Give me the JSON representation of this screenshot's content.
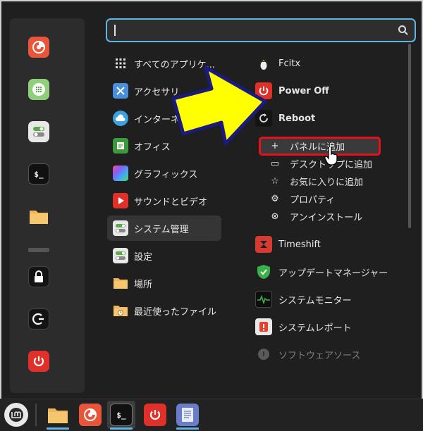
{
  "search": {
    "value": "",
    "placeholder": ""
  },
  "categories": [
    {
      "label": "すべてのアプリケ...",
      "icon": "grid-icon"
    },
    {
      "label": "アクセサリ",
      "icon": "accessories-icon"
    },
    {
      "label": "インターネ",
      "icon": "internet-icon"
    },
    {
      "label": "オフィス",
      "icon": "office-icon"
    },
    {
      "label": "グラフィックス",
      "icon": "graphics-icon"
    },
    {
      "label": "サウンドとビデオ",
      "icon": "multimedia-icon"
    },
    {
      "label": "システム管理",
      "icon": "system-admin-icon"
    },
    {
      "label": "設定",
      "icon": "settings-icon"
    },
    {
      "label": "場所",
      "icon": "folder-icon"
    },
    {
      "label": "最近使ったファイル",
      "icon": "recent-files-icon"
    }
  ],
  "apps_top": [
    {
      "label": "Fcitx",
      "icon": "penguin-icon"
    },
    {
      "label": "Power Off",
      "icon": "power-icon"
    },
    {
      "label": "Reboot",
      "icon": "reboot-icon"
    }
  ],
  "context_menu": [
    {
      "label": "パネルに追加",
      "glyph": "+"
    },
    {
      "label": "デスクトップに追加",
      "glyph": "▭"
    },
    {
      "label": "お気に入りに追加",
      "glyph": "☆"
    },
    {
      "label": "プロパティ",
      "glyph": "⚙"
    },
    {
      "label": "アンインストール",
      "glyph": "⊗"
    }
  ],
  "apps_bottom": [
    {
      "label": "Timeshift",
      "icon": "timeshift-icon"
    },
    {
      "label": "アップデートマネージャー",
      "icon": "update-shield-icon"
    },
    {
      "label": "システムモニター",
      "icon": "system-monitor-icon"
    },
    {
      "label": "システムレポート",
      "icon": "system-report-icon"
    },
    {
      "label": "ソフトウェアソース",
      "icon": "software-sources-icon"
    }
  ],
  "colors": {
    "accent": "#5fb4e8",
    "highlight_border": "#e8101c",
    "arrow_fill": "#ffff00"
  }
}
